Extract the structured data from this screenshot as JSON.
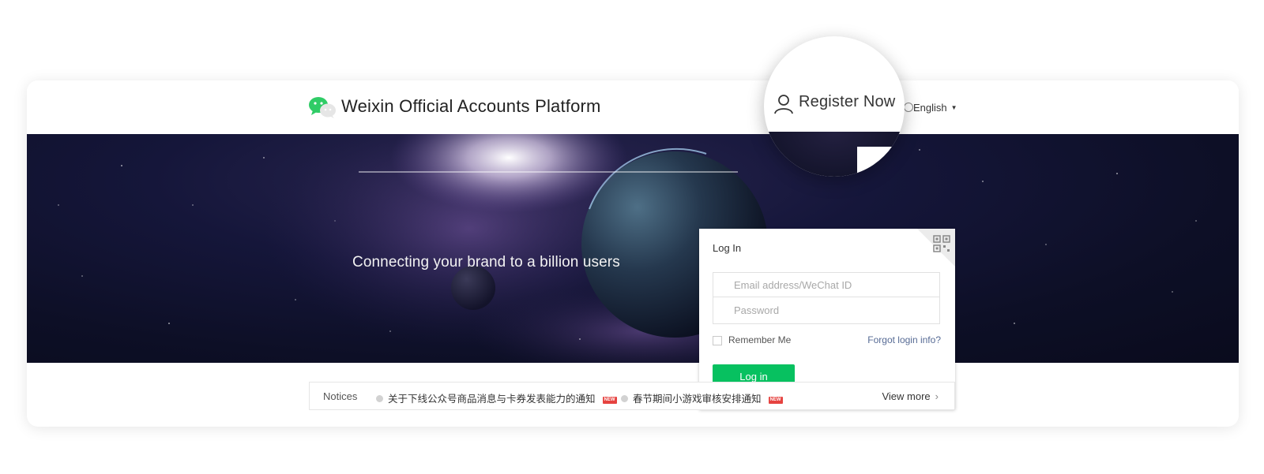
{
  "header": {
    "brand_title": "Weixin Official Accounts Platform",
    "language": "English",
    "register": "Register Now"
  },
  "banner": {
    "tagline": "Connecting your brand to a billion users"
  },
  "login": {
    "title": "Log In",
    "email_placeholder": "Email address/WeChat ID",
    "password_placeholder": "Password",
    "remember_label": "Remember Me",
    "forgot_label": "Forgot login info?",
    "button_label": "Log in"
  },
  "notices": {
    "label": "Notices",
    "items": [
      {
        "text": "关于下线公众号商品消息与卡券发表能力的通知",
        "badge": "NEW"
      },
      {
        "text": "春节期间小游戏审核安排通知",
        "badge": "NEW"
      }
    ],
    "view_more": "View more"
  },
  "colors": {
    "brand_green": "#07c160",
    "link_blue": "#576b95",
    "new_badge_red": "#e64340",
    "banner_dark": "#0d0f26"
  },
  "icons": [
    "wechat-logo-icon",
    "globe-icon",
    "qr-code-icon",
    "user-icon",
    "chevron-right-icon"
  ]
}
